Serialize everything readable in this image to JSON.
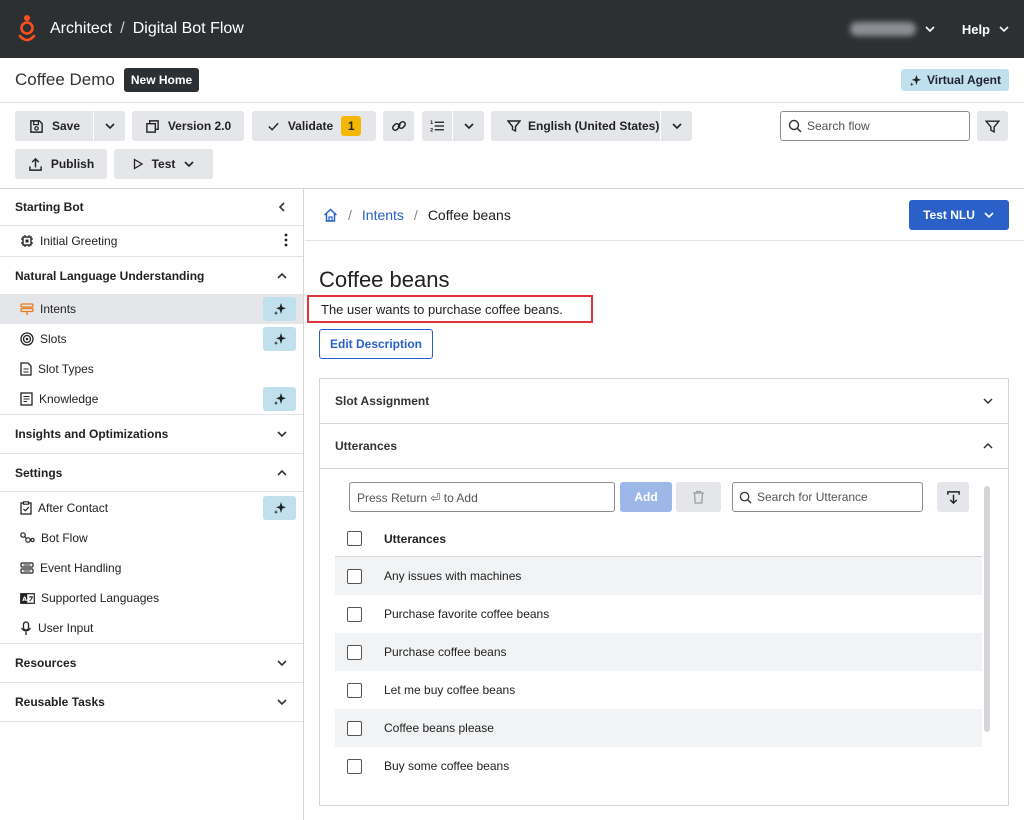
{
  "topbar": {
    "breadcrumb": [
      "Architect",
      "Digital Bot Flow"
    ],
    "help_label": "Help"
  },
  "flowbar": {
    "flow_name": "Coffee Demo",
    "badge": "New Home",
    "virtual_agent_label": "Virtual Agent"
  },
  "toolbar": {
    "save_label": "Save",
    "version_label": "Version 2.0",
    "validate_label": "Validate",
    "validate_count": "1",
    "language_label": "English (United States)",
    "search_placeholder": "Search flow",
    "publish_label": "Publish",
    "test_label": "Test"
  },
  "sidebar": {
    "starting_bot": {
      "title": "Starting Bot",
      "items": [
        {
          "label": "Initial Greeting"
        }
      ]
    },
    "nlu": {
      "title": "Natural Language Understanding",
      "items": [
        {
          "label": "Intents"
        },
        {
          "label": "Slots"
        },
        {
          "label": "Slot Types"
        },
        {
          "label": "Knowledge"
        }
      ]
    },
    "insights": {
      "title": "Insights and Optimizations"
    },
    "settings": {
      "title": "Settings",
      "items": [
        {
          "label": "After Contact"
        },
        {
          "label": "Bot Flow"
        },
        {
          "label": "Event Handling"
        },
        {
          "label": "Supported Languages"
        },
        {
          "label": "User Input"
        }
      ]
    },
    "resources": {
      "title": "Resources"
    },
    "reusable_tasks": {
      "title": "Reusable Tasks"
    }
  },
  "main": {
    "breadcrumb_link": "Intents",
    "breadcrumb_current": "Coffee beans",
    "test_nlu_label": "Test NLU",
    "intent_title": "Coffee beans",
    "intent_description": "The user wants to purchase coffee beans.",
    "edit_description_label": "Edit Description",
    "slot_assignment_title": "Slot Assignment",
    "utterances_title": "Utterances",
    "utterance_input_placeholder": "Press Return ⏎ to Add",
    "add_label": "Add",
    "utterance_search_placeholder": "Search for Utterance",
    "utterance_column_header": "Utterances",
    "utterances": [
      "Any issues with machines",
      "Purchase favorite coffee beans",
      "Purchase coffee beans",
      "Let me buy coffee beans",
      "Coffee beans please",
      "Buy some coffee beans"
    ]
  },
  "colors": {
    "topbar_bg": "#2d3033",
    "brand_orange": "#ff4f1f",
    "primary_blue": "#2a60c8",
    "ai_spark_bg": "#bfe0ec",
    "validate_badge": "#f5b800",
    "highlight_red": "#e0343c"
  },
  "icons": [
    "genesys-logo",
    "chevron-down-icon",
    "save-icon",
    "copy-icon",
    "check-icon",
    "link-icon",
    "list-icon",
    "filter-icon",
    "search-icon",
    "upload-icon",
    "play-icon",
    "chevron-left-icon",
    "chip-icon",
    "kebab-icon",
    "intent-icon",
    "target-icon",
    "document-icon",
    "book-icon",
    "clipboard-icon",
    "flow-icon",
    "event-icon",
    "language-icon",
    "microphone-icon",
    "home-icon",
    "trash-icon",
    "import-icon",
    "sparkle-icon"
  ]
}
